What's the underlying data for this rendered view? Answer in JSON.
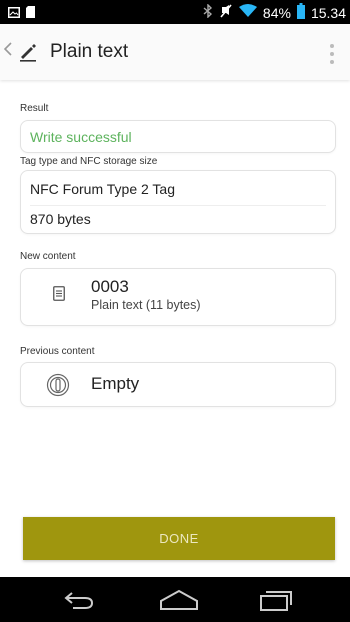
{
  "status_bar": {
    "battery_percent": "84%",
    "time": "15.34",
    "icons": [
      "image-icon",
      "sim-icon",
      "bluetooth-icon",
      "muted-icon",
      "wifi-icon",
      "battery-icon"
    ],
    "battery_level": 0.84,
    "battery_color": "#29b6f6"
  },
  "app_bar": {
    "title": "Plain text",
    "icons": [
      "back-chevron-icon",
      "pencil-icon",
      "overflow-menu-icon"
    ]
  },
  "result": {
    "label": "Result",
    "value": "Write successful",
    "value_color": "#5db35d"
  },
  "tag_info": {
    "label": "Tag type and NFC storage size",
    "tag_type": "NFC Forum Type 2 Tag",
    "storage_size": "870 bytes"
  },
  "new_content": {
    "label": "New content",
    "title": "0003",
    "subtitle": "Plain text (11 bytes)",
    "icon": "document-icon"
  },
  "previous_content": {
    "label": "Previous content",
    "value": "Empty",
    "icon": "empty-tag-icon"
  },
  "done_button": {
    "label": "DONE",
    "color": "#9f960e"
  },
  "nav_bar": {
    "icons": [
      "back-icon",
      "home-icon",
      "recents-icon"
    ]
  }
}
